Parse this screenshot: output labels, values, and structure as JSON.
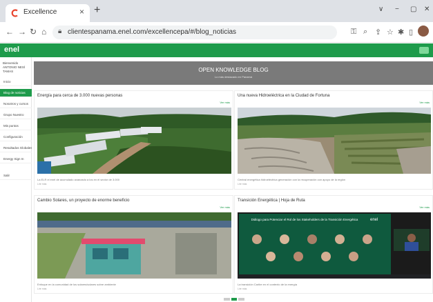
{
  "browser": {
    "tab_title": "Excellence",
    "close_glyph": "×",
    "newtab_glyph": "+",
    "url": "clientespanama.enel.com/excellencepa/#/blog_noticias",
    "controls": [
      "∨",
      "−",
      "▢",
      "✕"
    ]
  },
  "site": {
    "logo": "enel",
    "sidebar": {
      "user": "Bienvenido ANTONIO NESÍ TAMAS",
      "items": [
        "Inicio",
        "Blog de noticias",
        "Nosotros y cursos",
        "Grupo Nuestro",
        "Mis puntos",
        "Configuración",
        "Resultados Globales",
        "Energy Sign In",
        "Salir"
      ]
    },
    "banner": {
      "title": "OPEN KNOWLEDGE BLOG",
      "subtitle": "Lo más destacado en Panamá"
    },
    "cards": [
      {
        "title": "Energía para cerca de 3.000 nuevas personas",
        "link": "Ver más",
        "desc": "La ELR el enel de acumulado avanzado a los en el sector de 3.000",
        "date": "Lire más"
      },
      {
        "title": "Una nueva Hidroeléctrica en la Ciudad de Fortuna",
        "link": "Ver más",
        "desc": "Central energética hidroeléctrica generación con la recuperación con apoyo de la región",
        "date": "Lire más"
      },
      {
        "title": "Cambio Solares, un proyecto de enorme beneficio",
        "link": "Ver más",
        "desc": "Enfoque en la comunidad de los solares/solares sobre ambiente",
        "date": "Lire más"
      },
      {
        "title": "Transición Energética | Hoja de Ruta",
        "link": "Ver más",
        "desc": "La transición Caribe en el contexto de la energía",
        "date": "Lire más"
      }
    ],
    "webinar": {
      "brand": "enel",
      "headline": "Diálogo para Potenciar el Rol de los Stakeholders de la Transición Energética"
    }
  },
  "colors": {
    "brand_green": "#1e9b4b",
    "banner_gray": "#7a7a7a"
  }
}
